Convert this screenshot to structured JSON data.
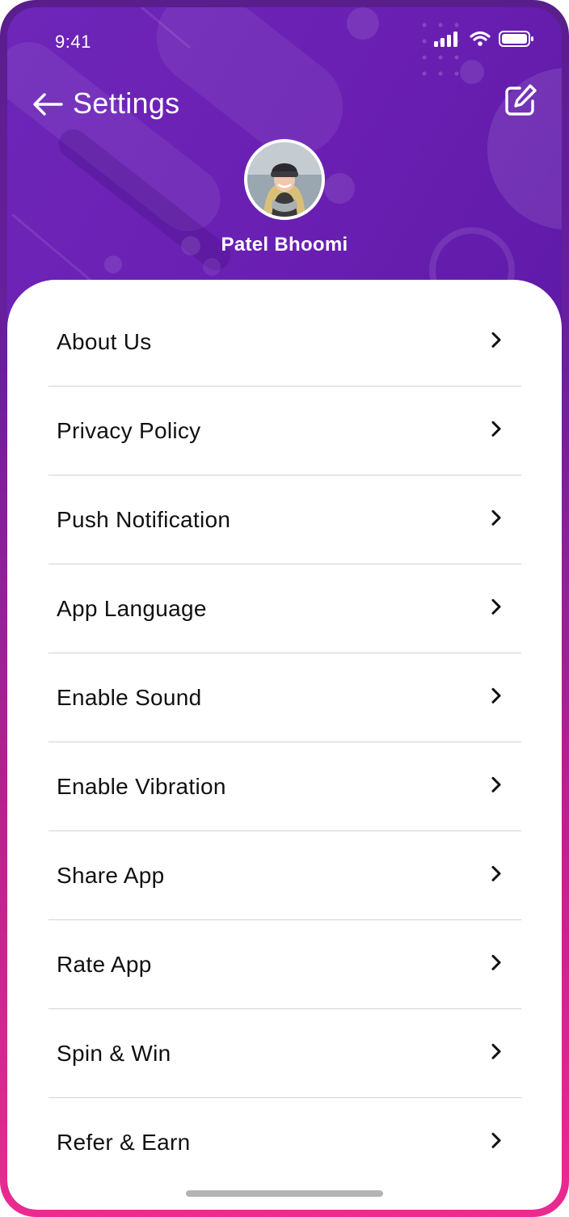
{
  "status_bar": {
    "time": "9:41"
  },
  "header": {
    "title": "Settings"
  },
  "profile": {
    "name": "Patel Bhoomi"
  },
  "settings_items": [
    {
      "label": "About Us"
    },
    {
      "label": "Privacy Policy"
    },
    {
      "label": "Push Notification"
    },
    {
      "label": "App Language"
    },
    {
      "label": "Enable Sound"
    },
    {
      "label": "Enable Vibration"
    },
    {
      "label": "Share App"
    },
    {
      "label": "Rate App"
    },
    {
      "label": "Spin & Win"
    },
    {
      "label": "Refer & Earn"
    }
  ],
  "icons": {
    "back": "arrow-left-icon",
    "edit": "edit-icon",
    "chevron": "chevron-right-icon",
    "signal": "signal-icon",
    "wifi": "wifi-icon",
    "battery": "battery-icon"
  },
  "colors": {
    "header_purple": "#6a22b6",
    "gradient_top": "#5a1e8c",
    "gradient_bottom": "#ea2b8f",
    "text_primary": "#111111",
    "divider": "#d2d2d2"
  }
}
